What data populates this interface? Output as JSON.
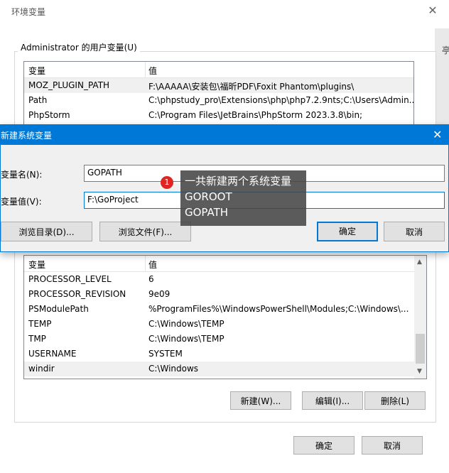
{
  "env_window": {
    "title": "环境变量",
    "close_glyph": "✕",
    "user_group_label": "Administrator 的用户变量(U)",
    "user_vars": {
      "col_name": "变量",
      "col_value": "值",
      "rows": [
        {
          "name": "MOZ_PLUGIN_PATH",
          "value": "F:\\AAAAA\\安装包\\福昕PDF\\Foxit Phantom\\plugins\\"
        },
        {
          "name": "Path",
          "value": "C:\\phpstudy_pro\\Extensions\\php\\php7.2.9nts;C:\\Users\\Admin..."
        },
        {
          "name": "PhpStorm",
          "value": "C:\\Program Files\\JetBrains\\PhpStorm 2023.3.8\\bin;"
        }
      ]
    },
    "system_vars": {
      "col_name": "变量",
      "col_value": "值",
      "rows": [
        {
          "name": "PROCESSOR_LEVEL",
          "value": "6"
        },
        {
          "name": "PROCESSOR_REVISION",
          "value": "9e09"
        },
        {
          "name": "PSModulePath",
          "value": "%ProgramFiles%\\WindowsPowerShell\\Modules;C:\\Windows\\..."
        },
        {
          "name": "TEMP",
          "value": "C:\\Windows\\TEMP"
        },
        {
          "name": "TMP",
          "value": "C:\\Windows\\TEMP"
        },
        {
          "name": "USERNAME",
          "value": "SYSTEM"
        },
        {
          "name": "windir",
          "value": "C:\\Windows"
        }
      ]
    },
    "system_buttons": {
      "new": "新建(W)...",
      "edit": "编辑(I)...",
      "delete": "删除(L)"
    },
    "ok": "确定",
    "cancel": "取消",
    "edge_char": "亭"
  },
  "new_var_dialog": {
    "title": "新建系统变量",
    "close_glyph": "✕",
    "name_label": "变量名(N):",
    "name_value": "GOPATH",
    "value_label": "变量值(V):",
    "value_value": "F:\\GoProject",
    "browse_dir": "浏览目录(D)...",
    "browse_file": "浏览文件(F)...",
    "ok": "确定",
    "cancel": "取消"
  },
  "annotation": {
    "badge": "1",
    "lines": [
      "一共新建两个系统变量",
      "GOROOT",
      "GOPATH"
    ]
  }
}
